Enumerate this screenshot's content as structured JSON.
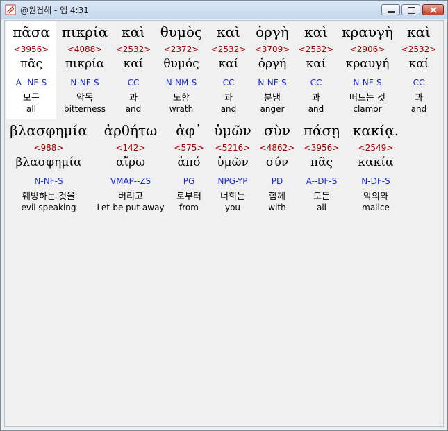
{
  "window": {
    "title": "@원겹해 - 엡 4:31"
  },
  "words_row1": [
    {
      "greek": "πᾶσα",
      "strong": "<3956>",
      "lemma": "πᾶς",
      "morph": "A--NF-S",
      "korean": "모든",
      "english": "all"
    },
    {
      "greek": "πικρία",
      "strong": "<4088>",
      "lemma": "πικρία",
      "morph": "N-NF-S",
      "korean": "악독",
      "english": "bitterness"
    },
    {
      "greek": "καὶ",
      "strong": "<2532>",
      "lemma": "καί",
      "morph": "CC",
      "korean": "과",
      "english": "and"
    },
    {
      "greek": "θυμὸς",
      "strong": "<2372>",
      "lemma": "θυμός",
      "morph": "N-NM-S",
      "korean": "노함",
      "english": "wrath"
    },
    {
      "greek": "καὶ",
      "strong": "<2532>",
      "lemma": "καί",
      "morph": "CC",
      "korean": "과",
      "english": "and"
    },
    {
      "greek": "ὀργὴ",
      "strong": "<3709>",
      "lemma": "ὀργή",
      "morph": "N-NF-S",
      "korean": "분냄",
      "english": "anger"
    },
    {
      "greek": "καὶ",
      "strong": "<2532>",
      "lemma": "καί",
      "morph": "CC",
      "korean": "과",
      "english": "and"
    },
    {
      "greek": "κραυγὴ",
      "strong": "<2906>",
      "lemma": "κραυγή",
      "morph": "N-NF-S",
      "korean": "떠드는 것",
      "english": "clamor"
    },
    {
      "greek": "καὶ",
      "strong": "<2532>",
      "lemma": "καί",
      "morph": "CC",
      "korean": "과",
      "english": "and"
    }
  ],
  "words_row2": [
    {
      "greek": "βλασφημία",
      "strong": "<988>",
      "lemma": "βλασφημία",
      "morph": "N-NF-S",
      "korean": "훼방하는 것을",
      "english": "evil speaking"
    },
    {
      "greek": "ἀρθήτω",
      "strong": "<142>",
      "lemma": "αἴρω",
      "morph": "VMAP--ZS",
      "korean": "버리고",
      "english": "Let-be put away"
    },
    {
      "greek": "ἀφ᾽",
      "strong": "<575>",
      "lemma": "ἀπό",
      "morph": "PG",
      "korean": "로부터",
      "english": "from"
    },
    {
      "greek": "ὑμῶν",
      "strong": "<5216>",
      "lemma": "ὑμῶν",
      "morph": "NPG-YP",
      "korean": "너희는",
      "english": "you"
    },
    {
      "greek": "σὺν",
      "strong": "<4862>",
      "lemma": "σύν",
      "morph": "PD",
      "korean": "함께",
      "english": "with"
    },
    {
      "greek": "πάσῃ",
      "strong": "<3956>",
      "lemma": "πᾶς",
      "morph": "A--DF-S",
      "korean": "모든",
      "english": "all"
    },
    {
      "greek": "κακίᾳ.",
      "strong": "<2549>",
      "lemma": "κακία",
      "morph": "N-DF-S",
      "korean": "악의와",
      "english": "malice"
    }
  ],
  "colors": {
    "strong": "#a00000",
    "morph": "#1a2bd0",
    "text": "#000000"
  },
  "icons": {
    "app": "app-book-icon",
    "min": "minimize-icon",
    "max": "maximize-icon",
    "close": "close-icon"
  }
}
